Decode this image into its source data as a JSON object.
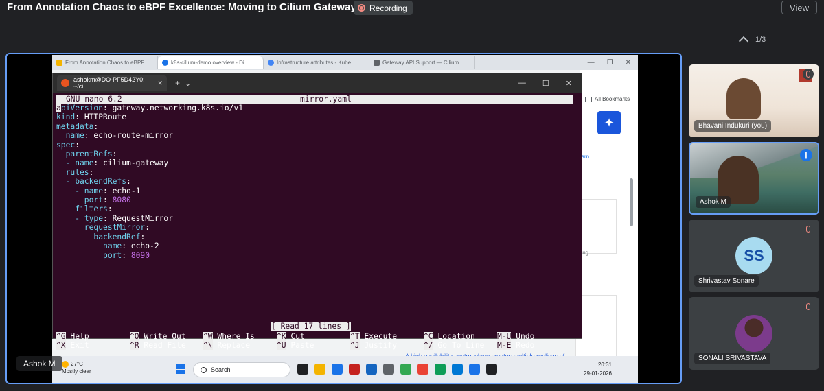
{
  "meeting": {
    "title": "From Annotation Chaos to eBPF Excellence: Moving to Cilium Gateway API",
    "recording_label": "Recording",
    "view_label": "View",
    "page_indicator": "1/3"
  },
  "browser": {
    "tabs": [
      {
        "label": "From Annotation Chaos to eBPF"
      },
      {
        "label": "k8s-cilium-demo overview - Di"
      },
      {
        "label": "Infrastructure attributes - Kube"
      },
      {
        "label": "Gateway API Support — Cilium"
      }
    ],
    "bookmarks_label": "All Bookmarks",
    "learn_label": "earn",
    "ning_label": "ning",
    "ha_text": "A high availability control plane creates multiple replicas of"
  },
  "terminal": {
    "tab_title": "ashokm@DO-PF5D42Y0: ~/ci",
    "nano_version": "GNU nano 6.2",
    "filename": "mirror.yaml",
    "status": "[ Read 17 lines ]",
    "lines": [
      [
        [
          "k",
          "apiVersion"
        ],
        [
          "v",
          ": gateway.networking.k8s.io/v1"
        ]
      ],
      [
        [
          "k",
          "kind"
        ],
        [
          "v",
          ": HTTPRoute"
        ]
      ],
      [
        [
          "k",
          "metadata"
        ],
        [
          "v",
          ":"
        ]
      ],
      [
        [
          "k",
          "  name"
        ],
        [
          "v",
          ": echo-route-mirror"
        ]
      ],
      [
        [
          "k",
          "spec"
        ],
        [
          "v",
          ":"
        ]
      ],
      [
        [
          "k",
          "  parentRefs"
        ],
        [
          "v",
          ":"
        ]
      ],
      [
        [
          "k",
          "  - name"
        ],
        [
          "v",
          ": cilium-gateway"
        ]
      ],
      [
        [
          "k",
          "  rules"
        ],
        [
          "v",
          ":"
        ]
      ],
      [
        [
          "k",
          "  - backendRefs"
        ],
        [
          "v",
          ":"
        ]
      ],
      [
        [
          "k",
          "    - name"
        ],
        [
          "v",
          ": echo-1"
        ]
      ],
      [
        [
          "k",
          "      port"
        ],
        [
          "v",
          ": "
        ],
        [
          "n",
          "8080"
        ]
      ],
      [
        [
          "k",
          "    filters"
        ],
        [
          "v",
          ":"
        ]
      ],
      [
        [
          "k",
          "    - type"
        ],
        [
          "v",
          ": RequestMirror"
        ]
      ],
      [
        [
          "k",
          "      requestMirror"
        ],
        [
          "v",
          ":"
        ]
      ],
      [
        [
          "k",
          "        backendRef"
        ],
        [
          "v",
          ":"
        ]
      ],
      [
        [
          "k",
          "          name"
        ],
        [
          "v",
          ": echo-2"
        ]
      ],
      [
        [
          "k",
          "          port"
        ],
        [
          "v",
          ": "
        ],
        [
          "n",
          "8090"
        ]
      ]
    ],
    "shortcuts": [
      {
        "key": "^G",
        "label": "Help"
      },
      {
        "key": "^O",
        "label": "Write Out"
      },
      {
        "key": "^W",
        "label": "Where Is"
      },
      {
        "key": "^K",
        "label": "Cut"
      },
      {
        "key": "^T",
        "label": "Execute"
      },
      {
        "key": "^C",
        "label": "Location"
      },
      {
        "key": "M-U",
        "label": "Undo"
      },
      {
        "key": "^X",
        "label": "Exit"
      },
      {
        "key": "^R",
        "label": "Read File"
      },
      {
        "key": "^\\",
        "label": "Replace"
      },
      {
        "key": "^U",
        "label": "Paste"
      },
      {
        "key": "^J",
        "label": "Justify"
      },
      {
        "key": "^/",
        "label": "Go To Line"
      },
      {
        "key": "M-E",
        "label": "Redo"
      }
    ]
  },
  "taskbar": {
    "temperature": "27°C",
    "weather": "Mostly clear",
    "search_placeholder": "Search",
    "time": "20:31",
    "date": "29-01-2026",
    "icon_colors": [
      "#202124",
      "#f4b400",
      "#1a73e8",
      "#c5221f",
      "#1565c0",
      "#5f6368",
      "#34a853",
      "#ea4335",
      "#0f9d58",
      "#0078d4",
      "#1a73e8",
      "#202124"
    ]
  },
  "presenter_tag": "Ashok M",
  "participants": [
    {
      "name": "Bhavani Indukuri (you)",
      "muted": true
    },
    {
      "name": "Ashok M",
      "speaking": true
    },
    {
      "name": "Shrivastav Sonare",
      "initials": "SS",
      "muted": true
    },
    {
      "name": "SONALI SRIVASTAVA",
      "muted": true
    }
  ]
}
